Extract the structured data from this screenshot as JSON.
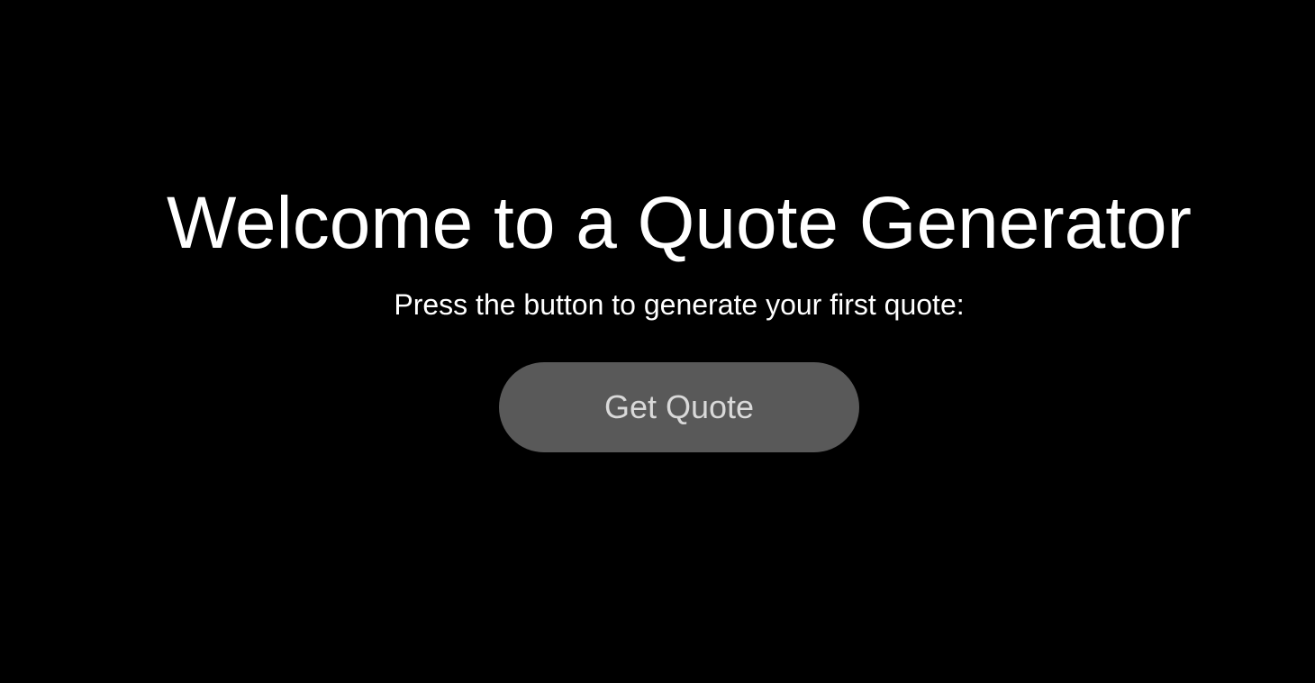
{
  "hero": {
    "title": "Welcome to a Quote Generator",
    "subtitle": "Press the button to generate your first quote:",
    "button_label": "Get Quote"
  },
  "colors": {
    "background": "#000000",
    "text": "#ffffff",
    "button_background": "#595959",
    "button_text": "#d9d9d9"
  }
}
